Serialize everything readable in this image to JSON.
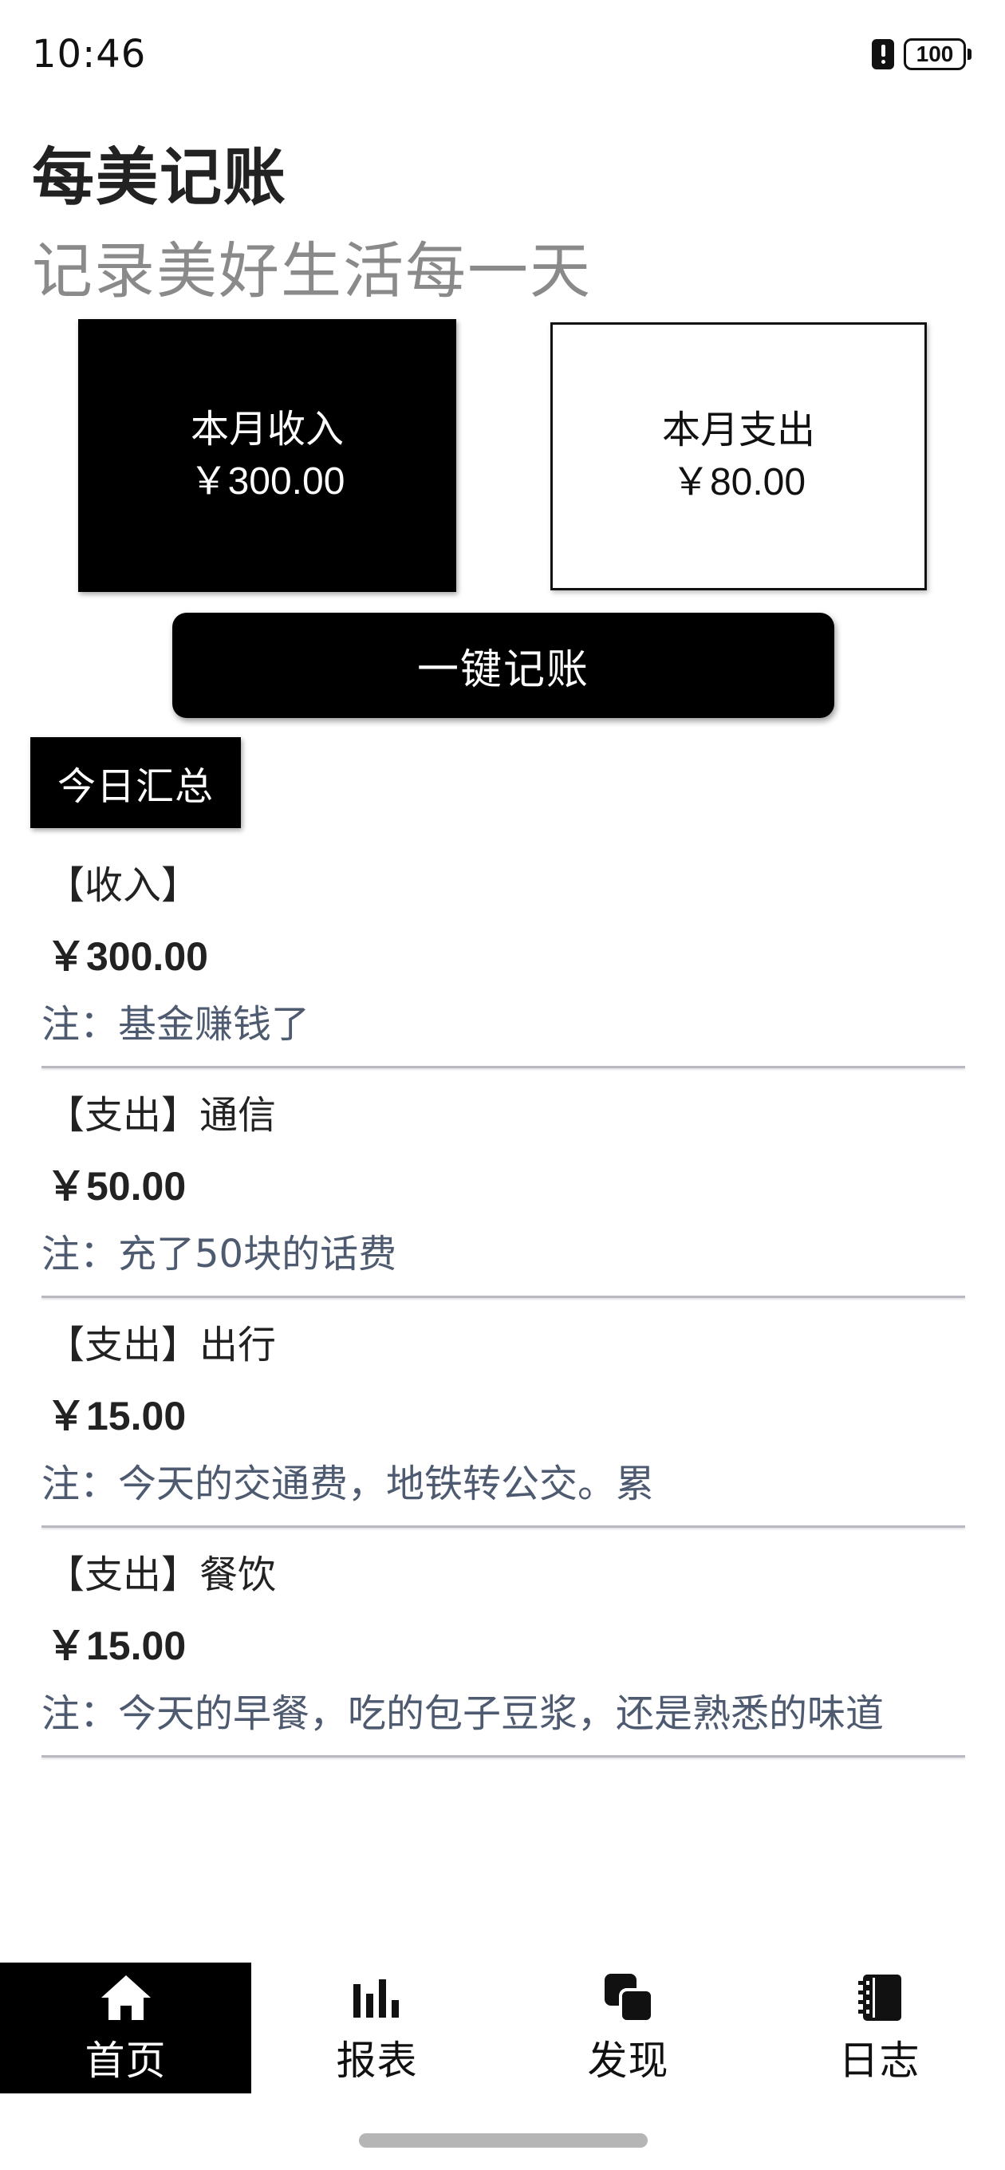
{
  "status_bar": {
    "time": "10:46",
    "battery": "100",
    "battery_level": 1.0
  },
  "header": {
    "title": "每美记账",
    "subtitle": "记录美好生活每一天"
  },
  "summary": {
    "income_label": "本月收入",
    "income_amount": "￥300.00",
    "expense_label": "本月支出",
    "expense_amount": "￥80.00"
  },
  "quick_button_label": "一键记账",
  "today_label": "今日汇总",
  "records": [
    {
      "type": "【收入】",
      "amount": "￥300.00",
      "note": "注：基金赚钱了"
    },
    {
      "type": "【支出】通信",
      "amount": "￥50.00",
      "note": "注：充了50块的话费"
    },
    {
      "type": "【支出】出行",
      "amount": "￥15.00",
      "note": "注：今天的交通费，地铁转公交。累"
    },
    {
      "type": "【支出】餐饮",
      "amount": "￥15.00",
      "note": "注：今天的早餐，吃的包子豆浆，还是熟悉的味道"
    }
  ],
  "nav": {
    "items": [
      {
        "label": "首页",
        "icon": "home-icon",
        "active": true
      },
      {
        "label": "报表",
        "icon": "bar-chart-icon",
        "active": false
      },
      {
        "label": "发现",
        "icon": "layers-icon",
        "active": false
      },
      {
        "label": "日志",
        "icon": "notebook-icon",
        "active": false
      }
    ]
  },
  "colors": {
    "primary": "#000000",
    "note_text": "#4e5a70",
    "subtitle_text": "#8a8a8a",
    "divider": "#b9b9c2"
  }
}
